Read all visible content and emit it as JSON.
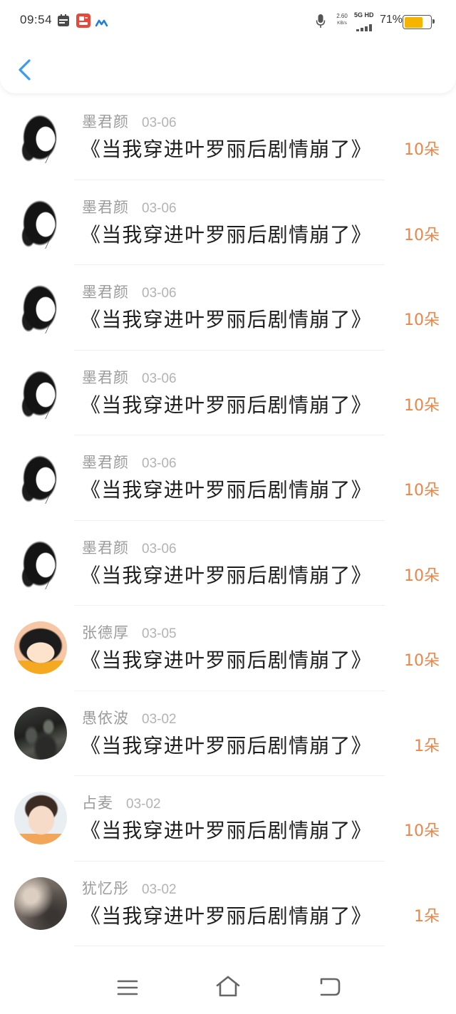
{
  "status_bar": {
    "time": "09:54",
    "net_speed": "2.60",
    "net_speed_unit": "KB/s",
    "network_type": "5G HD",
    "battery_text": "71%",
    "battery_level": 0.71,
    "left_icons": [
      "calendar-icon",
      "red-app-icon",
      "blue-app-icon"
    ],
    "right_icons": [
      "microphone-icon",
      "signal-icon",
      "battery-icon"
    ]
  },
  "header": {
    "back_icon": "chevron-left-icon"
  },
  "colors": {
    "accent": "#3a9cf0",
    "amount": "#ef8446",
    "name": "#9b9b9b",
    "date": "#b3b3b3",
    "title": "#1e1e1e",
    "battery": "#f5b400"
  },
  "list": {
    "items": [
      {
        "name": "墨君颜",
        "date": "03-06",
        "title": "《当我穿进叶罗丽后剧情崩了》",
        "amount": "10朵",
        "avatar": "sketch-girl"
      },
      {
        "name": "墨君颜",
        "date": "03-06",
        "title": "《当我穿进叶罗丽后剧情崩了》",
        "amount": "10朵",
        "avatar": "sketch-girl"
      },
      {
        "name": "墨君颜",
        "date": "03-06",
        "title": "《当我穿进叶罗丽后剧情崩了》",
        "amount": "10朵",
        "avatar": "sketch-girl"
      },
      {
        "name": "墨君颜",
        "date": "03-06",
        "title": "《当我穿进叶罗丽后剧情崩了》",
        "amount": "10朵",
        "avatar": "sketch-girl"
      },
      {
        "name": "墨君颜",
        "date": "03-06",
        "title": "《当我穿进叶罗丽后剧情崩了》",
        "amount": "10朵",
        "avatar": "sketch-girl"
      },
      {
        "name": "墨君颜",
        "date": "03-06",
        "title": "《当我穿进叶罗丽后剧情崩了》",
        "amount": "10朵",
        "avatar": "sketch-girl"
      },
      {
        "name": "张德厚",
        "date": "03-05",
        "title": "《当我穿进叶罗丽后剧情崩了》",
        "amount": "10朵",
        "avatar": "cartoon-girl"
      },
      {
        "name": "愚依波",
        "date": "03-02",
        "title": "《当我穿进叶罗丽后剧情崩了》",
        "amount": "1朵",
        "avatar": "soldiers"
      },
      {
        "name": "占麦",
        "date": "03-02",
        "title": "《当我穿进叶罗丽后剧情崩了》",
        "amount": "10朵",
        "avatar": "baby"
      },
      {
        "name": "犹忆彤",
        "date": "03-02",
        "title": "《当我穿进叶罗丽后剧情崩了》",
        "amount": "1朵",
        "avatar": "blurred-photo"
      }
    ]
  },
  "nav": {
    "icons": [
      "menu-icon",
      "home-icon",
      "back-icon"
    ]
  }
}
